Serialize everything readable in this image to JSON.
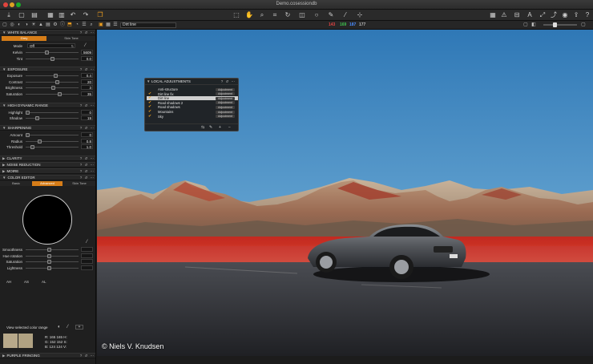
{
  "window": {
    "title": "Demo.cosessiondb"
  },
  "toolbar": {
    "left_icons": [
      "import-icon",
      "camera-icon",
      "folder-icon",
      "folder-out-icon",
      "trash-icon",
      "undo-icon",
      "redo-icon",
      "copy-apply-icon"
    ],
    "center_icons": [
      "select-cursor-icon",
      "pan-hand-icon",
      "zoom-icon",
      "crop-icon",
      "straighten-icon",
      "rotate-icon",
      "circle-icon",
      "brush-icon",
      "eyedropper-icon",
      "picker-icon"
    ],
    "right_icons": [
      "grid-icon",
      "warning-icon",
      "exposure-icon",
      "text-icon",
      "wand-icon",
      "rocket-icon",
      "mask-icon",
      "share-icon",
      "help-icon"
    ]
  },
  "subbar": {
    "layer_select": "Dirt line",
    "readout": {
      "r": "143",
      "g": "169",
      "b": "187",
      "l": "177"
    },
    "colors": {
      "r": "#e24444",
      "g": "#3fc24f",
      "b": "#4a8cff",
      "l": "#bbbbbb"
    }
  },
  "tools": {
    "white_balance": {
      "title": "WHITE BALANCE",
      "tabs": [
        "Grey",
        "Skin Tone"
      ],
      "mode_label": "Mode",
      "mode_value": "Off",
      "kelvin_label": "Kelvin",
      "kelvin_value": "5609",
      "tint_label": "Tint",
      "tint_value": "0.0"
    },
    "exposure": {
      "title": "EXPOSURE",
      "rows": [
        {
          "label": "Exposure",
          "value": "0.4",
          "knob": 0.58
        },
        {
          "label": "Contrast",
          "value": "20",
          "knob": 0.6
        },
        {
          "label": "Brightness",
          "value": "3",
          "knob": 0.52
        },
        {
          "label": "Saturation",
          "value": "35",
          "knob": 0.65
        }
      ]
    },
    "hdr": {
      "title": "HIGH DYNAMIC RANGE",
      "rows": [
        {
          "label": "Highlight",
          "value": "0",
          "knob": 0.0
        },
        {
          "label": "Shadow",
          "value": "19",
          "knob": 0.2
        }
      ]
    },
    "sharpening": {
      "title": "SHARPENING",
      "rows": [
        {
          "label": "Amount",
          "value": "0",
          "knob": 0.0
        },
        {
          "label": "Radius",
          "value": "0.8",
          "knob": 0.25
        },
        {
          "label": "Threshold",
          "value": "1.0",
          "knob": 0.1
        }
      ]
    },
    "clarity": {
      "title": "CLARITY"
    },
    "noise_reduction": {
      "title": "NOISE REDUCTION"
    },
    "moire": {
      "title": "MOIRE"
    },
    "color_editor": {
      "title": "COLOR EDITOR",
      "tabs": [
        "Basic",
        "Advanced",
        "Skin Tone"
      ],
      "rows": [
        {
          "label": "Smoothness",
          "knob": 0.45
        },
        {
          "label": "Hue rotation",
          "knob": 0.45
        },
        {
          "label": "Saturation",
          "knob": 0.45
        },
        {
          "label": "Lightness",
          "knob": 0.45
        }
      ],
      "footer_labels": [
        "AH",
        "AS",
        "AL"
      ],
      "view_selected": "View selected color range",
      "values": {
        "r": "R:  165  165  H:",
        "g": "G:  152  152  S:",
        "b": "B:  124  124  V:"
      }
    },
    "purple_fringing": {
      "title": "PURPLE FRINGING"
    }
  },
  "adjustments": {
    "title": "LOCAL ADJUSTMENTS",
    "badge": "Adjustment",
    "layers": [
      {
        "name": "Anti-structure",
        "checked": false,
        "selected": false
      },
      {
        "name": "Dirt line fix",
        "checked": true,
        "selected": false
      },
      {
        "name": "Dirt line",
        "checked": true,
        "selected": true
      },
      {
        "name": "Road shadows 2",
        "checked": true,
        "selected": false
      },
      {
        "name": "Road shadows",
        "checked": true,
        "selected": false
      },
      {
        "name": "Mountains",
        "checked": true,
        "selected": false
      },
      {
        "name": "Sky",
        "checked": true,
        "selected": false
      }
    ]
  },
  "viewer": {
    "copyright": "© Niels V. Knudsen"
  }
}
